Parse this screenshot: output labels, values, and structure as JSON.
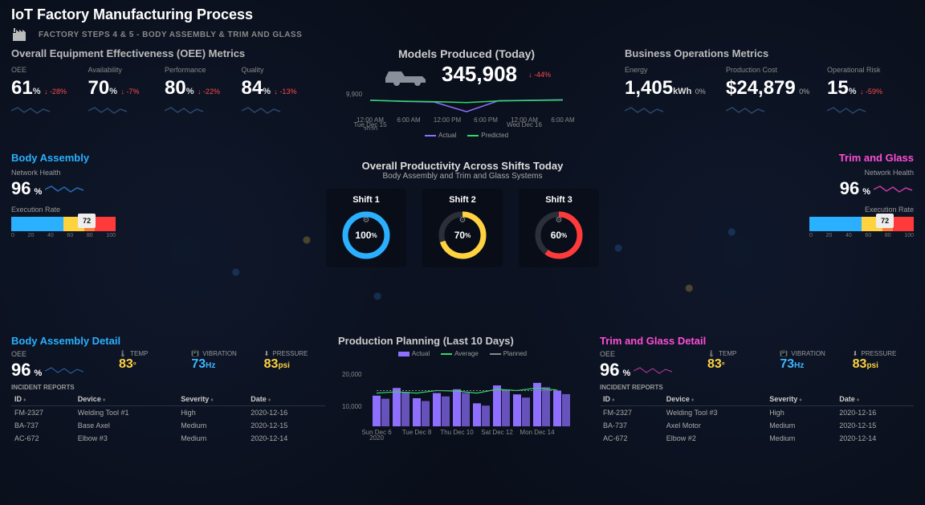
{
  "title": "IoT Factory Manufacturing Process",
  "subtitle": "FACTORY STEPS 4 & 5 - BODY ASSEMBLY & TRIM AND GLASS",
  "oee_section": {
    "title": "Overall Equipment Effectiveness (OEE) Metrics",
    "metrics": [
      {
        "label": "OEE",
        "value": "61",
        "unit": "%",
        "delta": "↓ -28%"
      },
      {
        "label": "Availability",
        "value": "70",
        "unit": "%",
        "delta": "↓ -7%"
      },
      {
        "label": "Performance",
        "value": "80",
        "unit": "%",
        "delta": "↓ -22%"
      },
      {
        "label": "Quality",
        "value": "84",
        "unit": "%",
        "delta": "↓ -13%"
      }
    ]
  },
  "models": {
    "title": "Models Produced (Today)",
    "value": "345,908",
    "delta": "↓ -44%",
    "yaxis": "9,900",
    "legend": {
      "actual": "Actual",
      "predicted": "Predicted"
    },
    "colors": {
      "actual": "#8f6fff",
      "predicted": "#2fd96a"
    },
    "xticks": [
      "12:00 AM\nTue Dec 15\n2020",
      "6:00 AM",
      "12:00 PM",
      "6:00 PM",
      "12:00 AM\nWed Dec 16",
      "6:00 AM"
    ]
  },
  "biz": {
    "title": "Business Operations Metrics",
    "metrics": [
      {
        "label": "Energy",
        "value": "1,405",
        "unit": "kWh",
        "delta": "0%",
        "zero": true
      },
      {
        "label": "Production Cost",
        "prefix": "$",
        "value": "24,879",
        "unit": "",
        "delta": "0%",
        "zero": true
      },
      {
        "label": "Operational Risk",
        "value": "15",
        "unit": "%",
        "delta": "↓ -59%"
      }
    ]
  },
  "body_assembly": {
    "title": "Body Assembly",
    "network_label": "Network Health",
    "network_value": "96",
    "exec_label": "Execution Rate",
    "exec_value": "72",
    "gauge_ticks": [
      "0",
      "20",
      "40",
      "60",
      "80",
      "100"
    ]
  },
  "trim_glass": {
    "title": "Trim and Glass",
    "network_label": "Network Health",
    "network_value": "96",
    "exec_label": "Execution Rate",
    "exec_value": "72",
    "gauge_ticks": [
      "0",
      "20",
      "40",
      "60",
      "80",
      "100"
    ]
  },
  "productivity": {
    "title": "Overall Productivity Across Shifts Today",
    "subtitle": "Body Assembly and Trim and Glass Systems",
    "shifts": [
      {
        "label": "Shift 1",
        "value": "100",
        "unit": "%",
        "color": "#2ab0ff"
      },
      {
        "label": "Shift 2",
        "value": "70",
        "unit": "%",
        "color": "#ffd23f"
      },
      {
        "label": "Shift 3",
        "value": "60",
        "unit": "%",
        "color": "#ff3a3a"
      }
    ]
  },
  "body_detail": {
    "title": "Body Assembly Detail",
    "oee_label": "OEE",
    "oee_value": "96",
    "temp_label": "TEMP",
    "temp_value": "83",
    "temp_unit": "°",
    "vib_label": "VIBRATION",
    "vib_value": "73",
    "vib_unit": "Hz",
    "press_label": "PRESSURE",
    "press_value": "83",
    "press_unit": "psi",
    "incidents_label": "INCIDENT REPORTS",
    "cols": [
      "ID",
      "Device",
      "Severity",
      "Date"
    ],
    "rows": [
      {
        "id": "FM-2327",
        "device": "Welding Tool #1",
        "sev": "High",
        "date": "2020-12-16"
      },
      {
        "id": "BA-737",
        "device": "Base Axel",
        "sev": "Medium",
        "date": "2020-12-15"
      },
      {
        "id": "AC-672",
        "device": "Elbow #3",
        "sev": "Medium",
        "date": "2020-12-14"
      }
    ]
  },
  "trim_detail": {
    "title": "Trim and Glass Detail",
    "oee_label": "OEE",
    "oee_value": "96",
    "temp_label": "TEMP",
    "temp_value": "83",
    "temp_unit": "°",
    "vib_label": "VIBRATION",
    "vib_value": "73",
    "vib_unit": "Hz",
    "press_label": "PRESSURE",
    "press_value": "83",
    "press_unit": "psi",
    "incidents_label": "INCIDENT REPORTS",
    "cols": [
      "ID",
      "Device",
      "Severity",
      "Date"
    ],
    "rows": [
      {
        "id": "FM-2327",
        "device": "Welding Tool #3",
        "sev": "High",
        "date": "2020-12-16"
      },
      {
        "id": "BA-737",
        "device": "Axel Motor",
        "sev": "Medium",
        "date": "2020-12-15"
      },
      {
        "id": "AC-672",
        "device": "Elbow #2",
        "sev": "Medium",
        "date": "2020-12-14"
      }
    ]
  },
  "planning": {
    "title": "Production Planning (Last 10 Days)",
    "legend": {
      "actual": "Actual",
      "average": "Average",
      "planned": "Planned"
    },
    "yticks": [
      "20,000",
      "10,000"
    ],
    "xticks": [
      "Sun Dec 6\n2020",
      "Tue Dec 8",
      "Thu Dec 10",
      "Sat Dec 12",
      "Mon Dec 14"
    ]
  },
  "chart_data": {
    "models_produced": {
      "type": "line",
      "title": "Models Produced (Today)",
      "x": [
        "12:00 AM",
        "6:00 AM",
        "12:00 PM",
        "6:00 PM",
        "12:00 AM",
        "6:00 AM"
      ],
      "ylim": [
        9400,
        10100
      ],
      "yticks": [
        9900
      ],
      "series": [
        {
          "name": "Actual",
          "color": "#8f6fff",
          "values": [
            10000,
            9950,
            9920,
            9500,
            9980,
            10000,
            10020
          ]
        },
        {
          "name": "Predicted",
          "color": "#2fd96a",
          "values": [
            10000,
            9960,
            9940,
            9900,
            9970,
            9990,
            10010
          ]
        }
      ]
    },
    "oee_sparks": {
      "type": "line",
      "series": [
        {
          "name": "OEE",
          "values": [
            62,
            58,
            64,
            60,
            63,
            59,
            61
          ]
        },
        {
          "name": "Availability",
          "values": [
            72,
            68,
            74,
            69,
            73,
            70,
            70
          ]
        },
        {
          "name": "Performance",
          "values": [
            82,
            78,
            84,
            79,
            83,
            80,
            80
          ]
        },
        {
          "name": "Quality",
          "values": [
            86,
            82,
            88,
            83,
            87,
            84,
            84
          ]
        }
      ]
    },
    "biz_sparks": {
      "type": "line",
      "series": [
        {
          "name": "Energy",
          "values": [
            1400,
            1380,
            1420,
            1405,
            1410,
            1395,
            1405
          ]
        },
        {
          "name": "Production Cost",
          "values": [
            24500,
            24800,
            24700,
            24900,
            24850,
            24879,
            24879
          ]
        },
        {
          "name": "Operational Risk",
          "values": [
            30,
            25,
            20,
            18,
            16,
            15,
            15
          ]
        }
      ]
    },
    "shifts": {
      "type": "pie",
      "series": [
        {
          "name": "Shift 1",
          "values": [
            100
          ],
          "color": "#2ab0ff"
        },
        {
          "name": "Shift 2",
          "values": [
            70
          ],
          "color": "#ffd23f"
        },
        {
          "name": "Shift 3",
          "values": [
            60
          ],
          "color": "#ff3a3a"
        }
      ]
    },
    "production_planning": {
      "type": "bar",
      "title": "Production Planning (Last 10 Days)",
      "ylim": [
        0,
        22000
      ],
      "yticks": [
        10000,
        20000
      ],
      "x": [
        "Dec 6",
        "Dec 7",
        "Dec 8",
        "Dec 9",
        "Dec 10",
        "Dec 11",
        "Dec 12",
        "Dec 13",
        "Dec 14",
        "Dec 15"
      ],
      "series": [
        {
          "name": "Actual",
          "color": "#8f6fff",
          "values": [
            12000,
            15000,
            11000,
            13000,
            14500,
            9000,
            16000,
            12500,
            17000,
            14000
          ]
        },
        {
          "name": "Average",
          "color": "#2fd96a",
          "values": [
            13000,
            13500,
            13000,
            14000,
            13800,
            13000,
            14500,
            14000,
            15000,
            14200
          ]
        },
        {
          "name": "Planned",
          "color": "#888",
          "values": [
            14000,
            14000,
            14000,
            14000,
            14000,
            14000,
            14000,
            14000,
            14000,
            14000
          ]
        }
      ]
    }
  }
}
